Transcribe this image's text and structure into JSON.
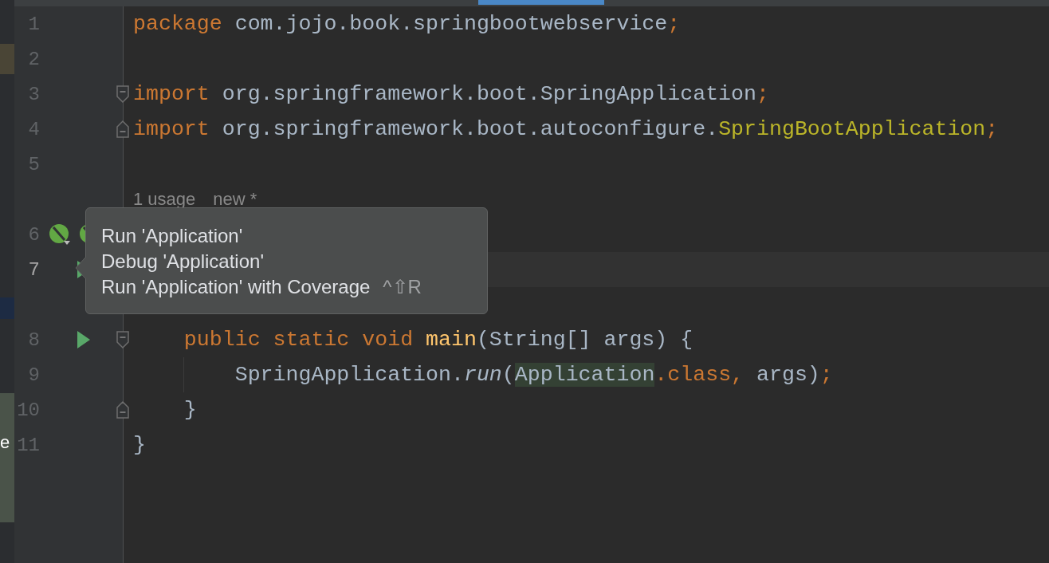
{
  "side_edge": {
    "text": "e"
  },
  "lines": [
    {
      "kind": "code",
      "number": "1",
      "current": false,
      "tokens": [
        {
          "kind": "kw",
          "t": "package "
        },
        {
          "kind": "plain",
          "t": "com.jojo.book.springbootwebservice"
        },
        {
          "kind": "kw",
          "t": ";"
        }
      ]
    },
    {
      "kind": "code",
      "number": "2",
      "current": false
    },
    {
      "kind": "code",
      "number": "3",
      "current": false,
      "fold_start": true,
      "tokens": [
        {
          "kind": "kw",
          "t": "import "
        },
        {
          "kind": "plain",
          "t": "org.springframework.boot.SpringApplication"
        },
        {
          "kind": "kw",
          "t": ";"
        }
      ]
    },
    {
      "kind": "code",
      "number": "4",
      "current": false,
      "fold_end": true,
      "tokens": [
        {
          "kind": "kw",
          "t": "import "
        },
        {
          "kind": "plain",
          "t": "org.springframework.boot.autoconfigure."
        },
        {
          "kind": "annot",
          "t": "SpringBootApplication"
        },
        {
          "kind": "kw",
          "t": ";"
        }
      ]
    },
    {
      "kind": "code",
      "number": "5",
      "current": false
    },
    {
      "kind": "hint",
      "hints": [
        "1 usage",
        "new *"
      ]
    },
    {
      "kind": "code",
      "number": "6",
      "current": false,
      "gutter_icons": [
        {
          "kind": "bean"
        },
        {
          "kind": "bean"
        }
      ]
    },
    {
      "kind": "code",
      "number": "7",
      "current": true,
      "gutter_icons": [
        {
          "kind": "run"
        }
      ]
    },
    {
      "kind": "hint"
    },
    {
      "kind": "code",
      "number": "8",
      "current": false,
      "gutter_icons": [
        {
          "kind": "run"
        }
      ],
      "fold_start": true,
      "tokens": [
        {
          "kind": "kw",
          "t": "    public static void "
        },
        {
          "kind": "fn",
          "t": "main"
        },
        {
          "kind": "plain",
          "t": "(String[] args) {"
        }
      ]
    },
    {
      "kind": "code",
      "number": "9",
      "current": false,
      "guide": true,
      "tokens": [
        {
          "kind": "plain",
          "t": "        SpringApplication."
        },
        {
          "kind": "call",
          "t": "run"
        },
        {
          "kind": "plain",
          "t": "("
        },
        {
          "kind": "usage",
          "t": "Application"
        },
        {
          "kind": "kw",
          "t": ".class, "
        },
        {
          "kind": "plain",
          "t": "args)"
        },
        {
          "kind": "kw",
          "t": ";"
        }
      ]
    },
    {
      "kind": "code",
      "number": "10",
      "current": false,
      "fold_end": true,
      "tokens": [
        {
          "kind": "plain",
          "t": "    }"
        }
      ]
    },
    {
      "kind": "code",
      "number": "11",
      "current": false,
      "tokens": [
        {
          "kind": "plain",
          "t": "}"
        }
      ]
    }
  ],
  "popup": {
    "items": [
      {
        "label": "Run 'Application'"
      },
      {
        "label": "Debug 'Application'"
      },
      {
        "label": "Run 'Application' with Coverage",
        "shortcut": "^⇧R"
      }
    ]
  }
}
